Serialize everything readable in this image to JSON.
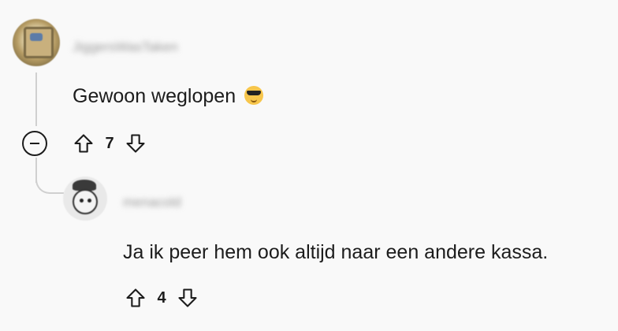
{
  "comments": [
    {
      "username": "JiggersWasTaken",
      "text": "Gewoon weglopen",
      "emoji": "smiling-face-with-sunglasses",
      "score": "7"
    },
    {
      "username": "menacold",
      "text": "Ja ik peer hem ook altijd naar een andere kassa.",
      "score": "4"
    }
  ],
  "icons": {
    "collapse": "minus-circle-icon",
    "upvote": "arrow-up-outline-icon",
    "downvote": "arrow-down-outline-icon"
  },
  "colors": {
    "background": "#f9f9f9",
    "text": "#1c1c1c",
    "thread_line": "#d0d0d0",
    "muted": "#9a9a9a"
  }
}
